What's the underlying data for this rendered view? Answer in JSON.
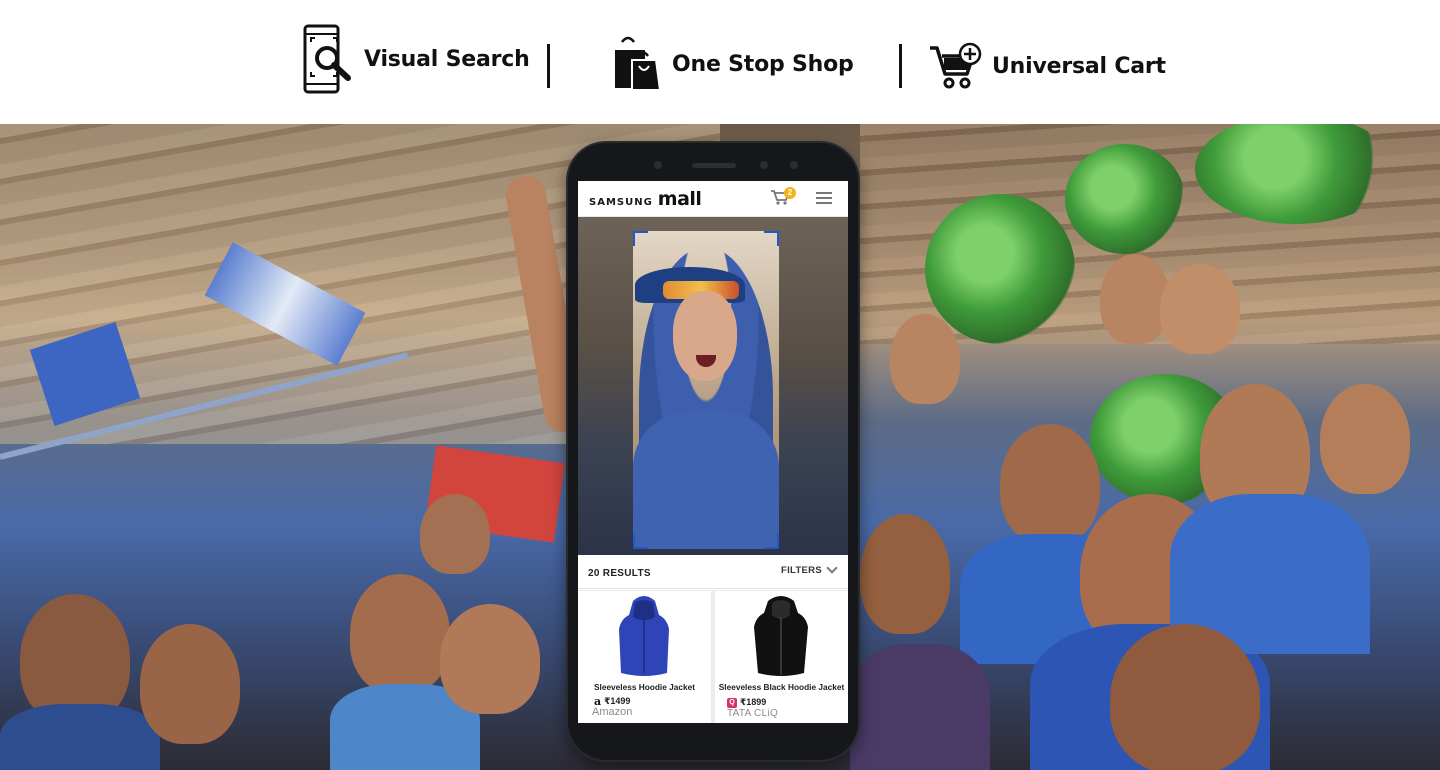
{
  "features": [
    {
      "label": "Visual Search",
      "icon": "phone-search-icon"
    },
    {
      "label": "One Stop Shop",
      "icon": "shopping-bags-icon"
    },
    {
      "label": "Universal Cart",
      "icon": "cart-add-icon"
    }
  ],
  "phone": {
    "app": {
      "brand_small": "SAMSUNG",
      "brand_large": "mall",
      "cart_badge": "2",
      "results_count": "20 RESULTS",
      "filters_label": "FILTERS",
      "products": [
        {
          "name": "Sleeveless Hoodie Jacket",
          "price": "₹1499",
          "seller": "Amazon",
          "seller_mark": "a",
          "color": "#2f44b6"
        },
        {
          "name": "Sleeveless Black Hoodie Jacket",
          "price": "₹1899",
          "seller": "TATA CLiQ",
          "seller_mark": "Q",
          "color": "#111111"
        }
      ]
    }
  },
  "colors": {
    "accent": "#2457c9",
    "badge": "#f2b418",
    "text": "#111111"
  }
}
